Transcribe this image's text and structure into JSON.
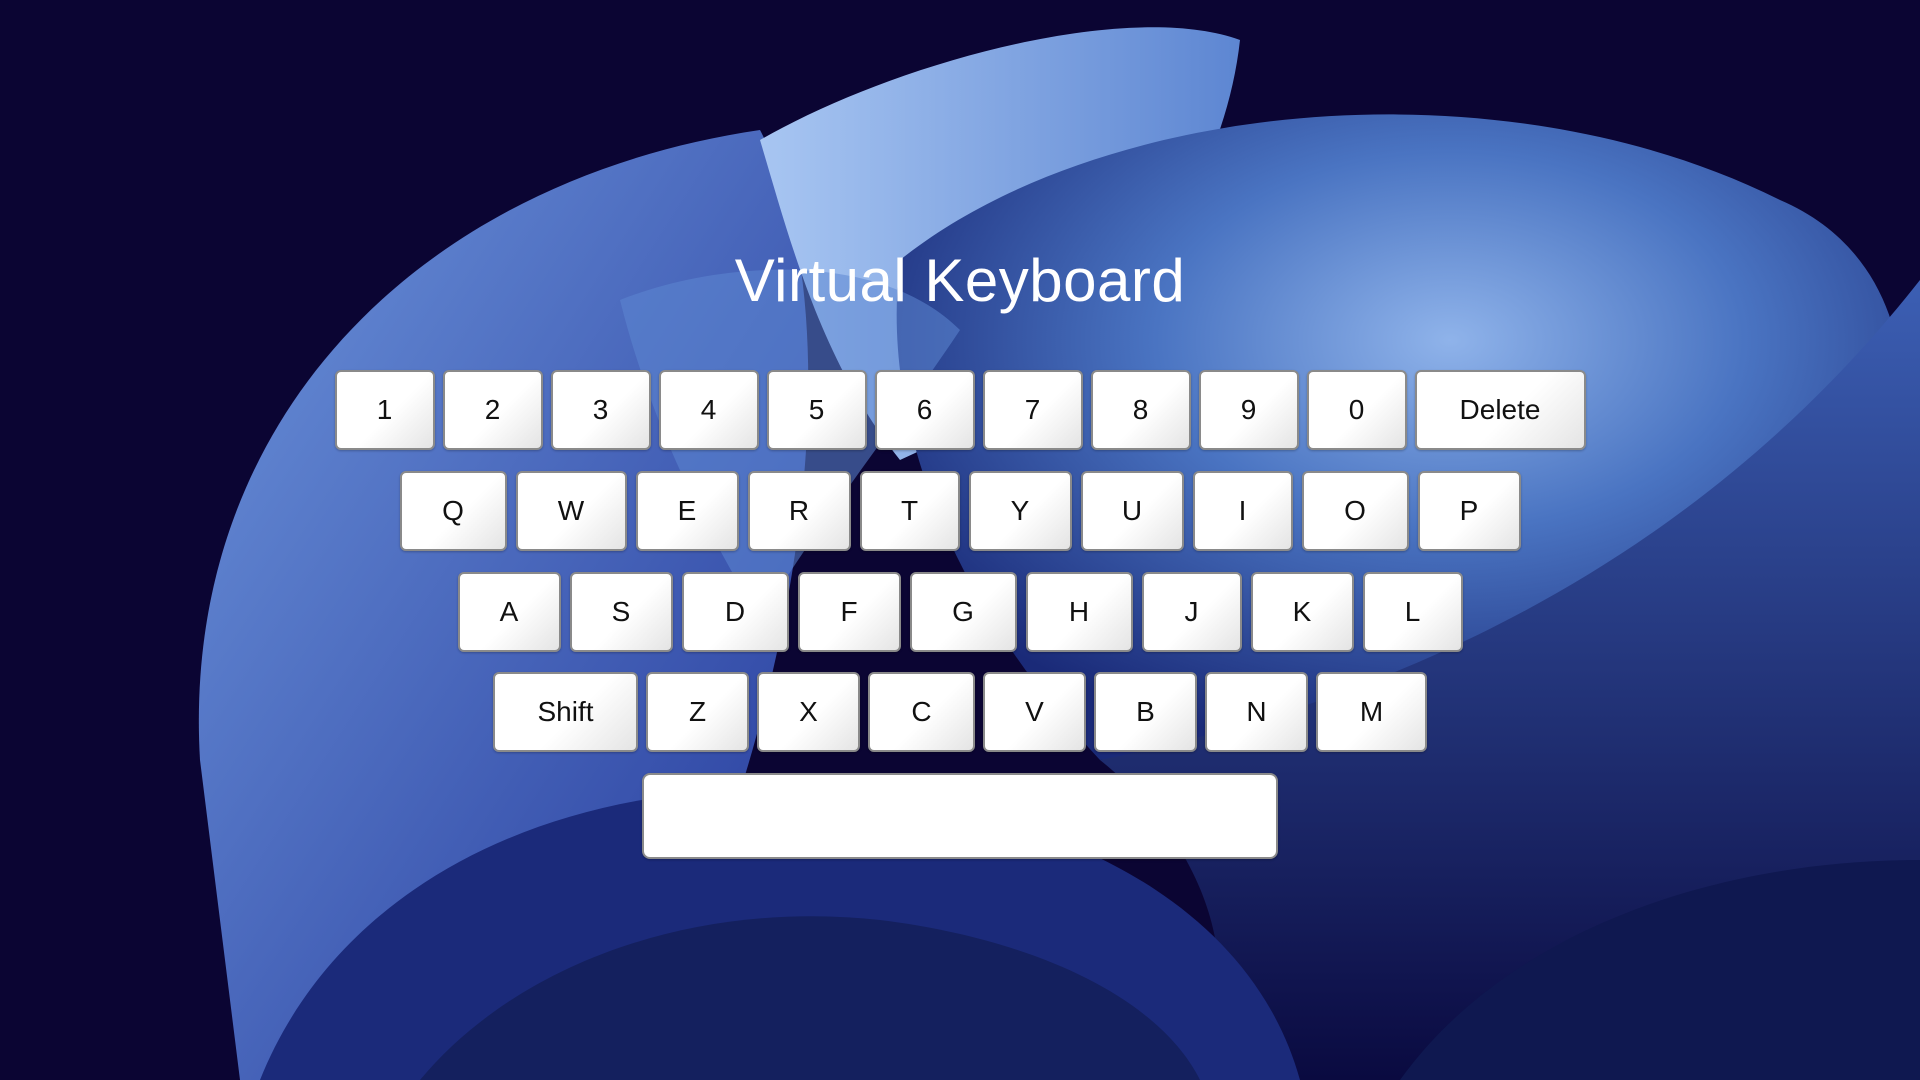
{
  "title": "Virtual Keyboard",
  "rows": {
    "numbers": [
      "1",
      "2",
      "3",
      "4",
      "5",
      "6",
      "7",
      "8",
      "9",
      "0"
    ],
    "delete_label": "Delete",
    "top": [
      "Q",
      "W",
      "E",
      "R",
      "T",
      "Y",
      "U",
      "I",
      "O",
      "P"
    ],
    "middle": [
      "A",
      "S",
      "D",
      "F",
      "G",
      "H",
      "J",
      "K",
      "L"
    ],
    "shift_label": "Shift",
    "bottom": [
      "Z",
      "X",
      "C",
      "V",
      "B",
      "N",
      "M"
    ],
    "space_label": ""
  },
  "colors": {
    "background": "#0b0533",
    "wallpaper_accent": "#4a74c2",
    "key_face": "#ffffff",
    "key_border": "#8a8a8a",
    "title_text": "#ffffff"
  }
}
